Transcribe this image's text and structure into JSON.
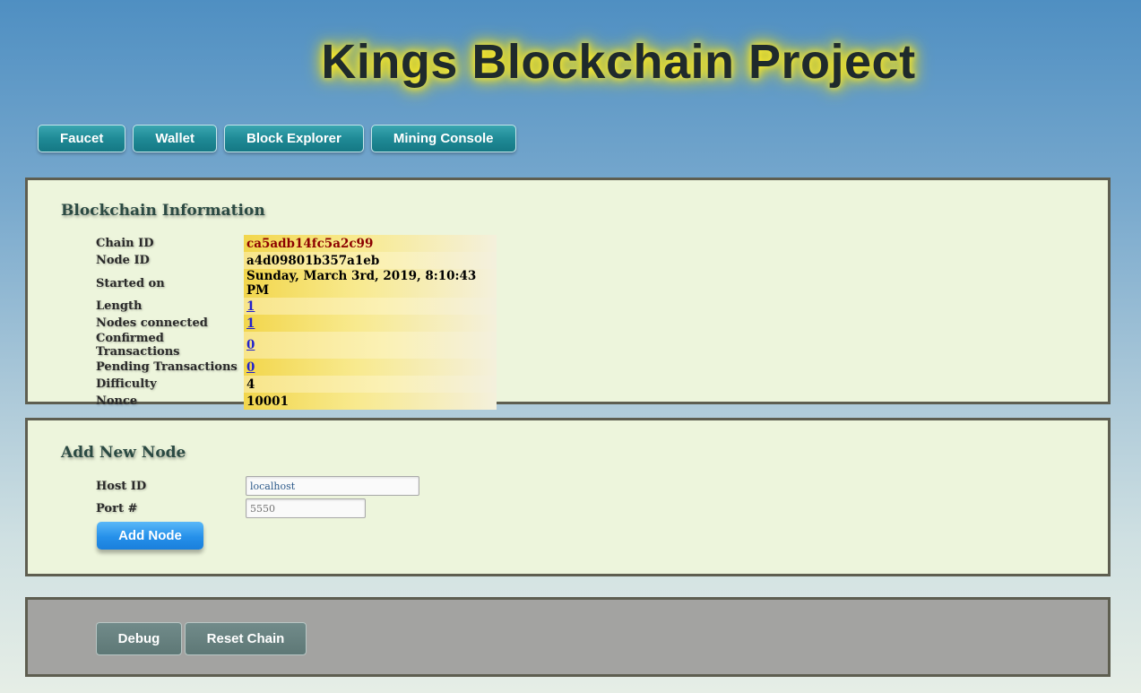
{
  "header": {
    "title": "Kings Blockchain Project"
  },
  "nav": {
    "items": [
      {
        "label": "Faucet"
      },
      {
        "label": "Wallet"
      },
      {
        "label": "Block Explorer"
      },
      {
        "label": "Mining Console"
      }
    ]
  },
  "blockchain_info": {
    "heading": "Blockchain Information",
    "rows": [
      {
        "label": "Chain ID",
        "value": "ca5adb14fc5a2c99"
      },
      {
        "label": "Node ID",
        "value": "a4d09801b357a1eb"
      },
      {
        "label": "Started on",
        "value": "Sunday, March 3rd, 2019, 8:10:43 PM"
      },
      {
        "label": "Length",
        "value": "1"
      },
      {
        "label": "Nodes connected",
        "value": "1"
      },
      {
        "label": "Confirmed Transactions",
        "value": "0"
      },
      {
        "label": "Pending Transactions",
        "value": "0"
      },
      {
        "label": "Difficulty",
        "value": "4"
      },
      {
        "label": "Nonce",
        "value": "10001"
      }
    ]
  },
  "add_node": {
    "heading": "Add New Node",
    "host_label": "Host ID",
    "host_value": "localhost",
    "port_label": "Port #",
    "port_placeholder": "5550",
    "submit_label": "Add Node"
  },
  "debug_panel": {
    "debug_label": "Debug",
    "reset_label": "Reset Chain"
  },
  "colors": {
    "nav_button": "#1f8a96",
    "add_node_button": "#2590ea",
    "panel_background": "#edf5dc",
    "debug_panel_background": "#a3a3a1",
    "chain_id_text": "#8b0000",
    "link_text": "#2222cc"
  }
}
